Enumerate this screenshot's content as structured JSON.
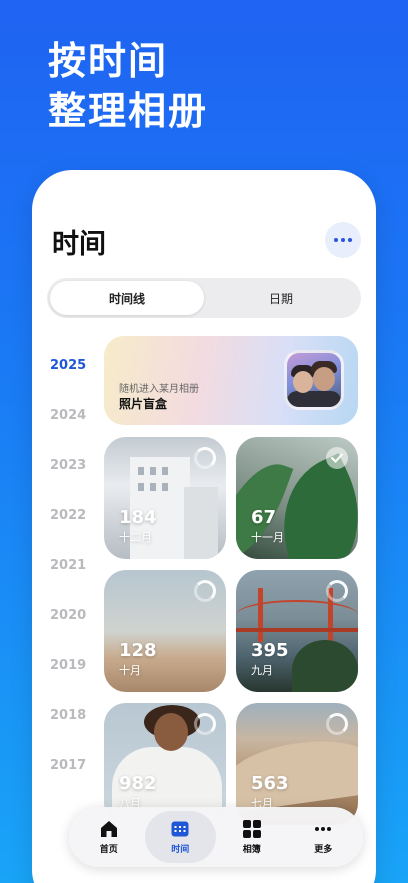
{
  "headline": {
    "line1": "按时间",
    "line2": "整理相册"
  },
  "page": {
    "title": "时间"
  },
  "segment": {
    "tab1": "时间线",
    "tab2": "日期"
  },
  "years": [
    "2025",
    "2024",
    "2023",
    "2022",
    "2021",
    "2020",
    "2019",
    "2018",
    "2017"
  ],
  "active_year": "2025",
  "banner": {
    "subtitle": "随机进入某月相册",
    "title": "照片盲盒"
  },
  "cards": [
    {
      "count": "184",
      "month": "十二月",
      "status": "progress-ring"
    },
    {
      "count": "67",
      "month": "十一月",
      "status": "checked"
    },
    {
      "count": "128",
      "month": "十月",
      "status": "progress-ring"
    },
    {
      "count": "395",
      "month": "九月",
      "status": "progress-ring"
    },
    {
      "count": "982",
      "month": "八月",
      "status": "progress-ring"
    },
    {
      "count": "563",
      "month": "七月",
      "status": "progress-ring"
    }
  ],
  "tabbar": {
    "home": "首页",
    "time": "时间",
    "albums": "相簿",
    "more": "更多"
  },
  "colors": {
    "accent": "#2057d6",
    "background_top": "#1f63f2",
    "background_bottom": "#19a4f7"
  },
  "icons": [
    "more-dots-icon",
    "home-icon",
    "calendar-icon",
    "grid-icon",
    "more-icon",
    "checkmark-icon",
    "progress-ring-icon"
  ]
}
